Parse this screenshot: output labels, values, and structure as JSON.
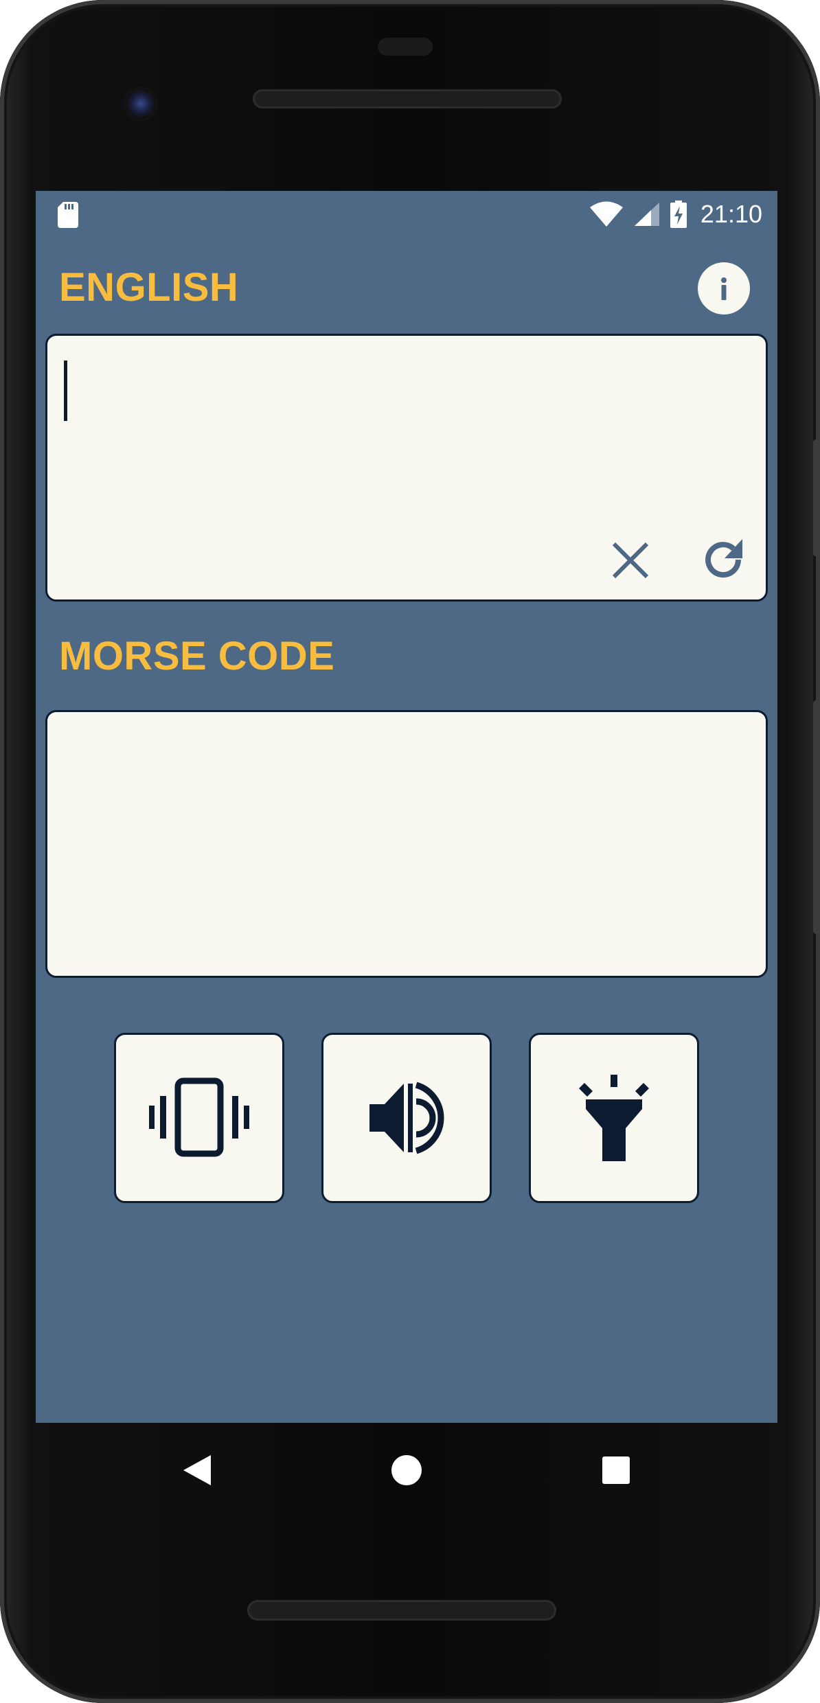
{
  "status_bar": {
    "time": "21:10",
    "icons": [
      "sd-card-icon",
      "wifi-icon",
      "signal-icon",
      "battery-charging-icon"
    ]
  },
  "english_section": {
    "title": "ENGLISH",
    "input_value": "",
    "info_icon": "info-icon",
    "clear_icon": "close-icon",
    "refresh_icon": "refresh-icon"
  },
  "morse_section": {
    "title": "MORSE CODE",
    "output_value": ""
  },
  "actions": {
    "vibrate_icon": "vibrate-icon",
    "sound_icon": "speaker-icon",
    "flash_icon": "flashlight-icon"
  },
  "nav_bar": {
    "back_icon": "back-icon",
    "home_icon": "home-icon",
    "recent_icon": "recent-apps-icon"
  },
  "colors": {
    "background": "#4d6986",
    "accent": "#f8bd3f",
    "panel": "#f9f8f0",
    "icon_dark": "#0d1b30",
    "icon_muted": "#4d6986"
  }
}
